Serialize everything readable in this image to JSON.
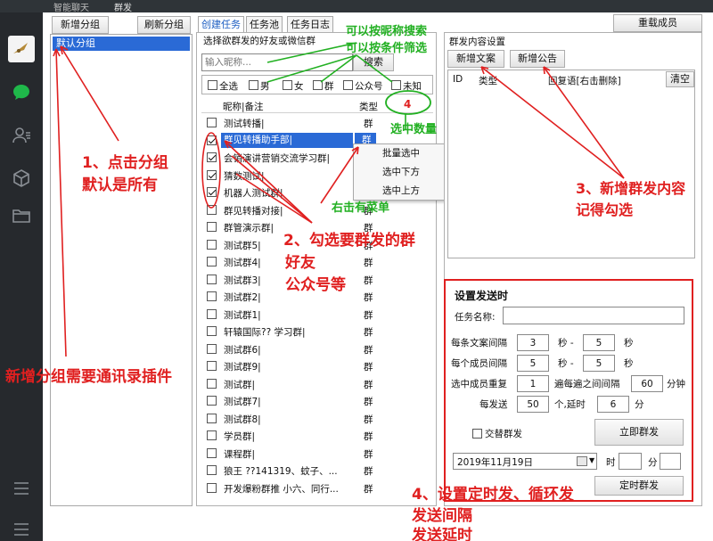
{
  "topbar": {
    "tab1": "智能聊天",
    "tab2": "群发"
  },
  "groups": {
    "add_btn": "新增分组",
    "refresh_btn": "刷新分组",
    "items": [
      "默认分组"
    ]
  },
  "tabs": [
    "创建任务",
    "任务池",
    "任务日志"
  ],
  "reload_btn": "重载成员",
  "friend_panel": {
    "title": "选择欲群发的好友或微信群",
    "search_placeholder": "输入昵称...",
    "search_btn": "搜索",
    "filters": [
      "全选",
      "男",
      "女",
      "群",
      "公众号",
      "未知"
    ],
    "col_name": "昵称|备注",
    "col_type": "类型",
    "selected_count": "4",
    "rows": [
      {
        "name": "测试转播|",
        "type": "群",
        "checked": false,
        "selected": false
      },
      {
        "name": "群见转播助手部|",
        "type": "群",
        "checked": true,
        "selected": true
      },
      {
        "name": "会销演讲营销交流学习群|",
        "type": "群",
        "checked": true,
        "selected": false
      },
      {
        "name": "猜数测试|",
        "type": "群",
        "checked": true,
        "selected": false
      },
      {
        "name": "机器人测试群|",
        "type": "群",
        "checked": true,
        "selected": false
      },
      {
        "name": "群见转播对接|",
        "type": "群",
        "checked": false,
        "selected": false
      },
      {
        "name": "群管演示群|",
        "type": "群",
        "checked": false,
        "selected": false
      },
      {
        "name": "测试群5|",
        "type": "群",
        "checked": false,
        "selected": false
      },
      {
        "name": "测试群4|",
        "type": "群",
        "checked": false,
        "selected": false
      },
      {
        "name": "测试群3|",
        "type": "群",
        "checked": false,
        "selected": false
      },
      {
        "name": "测试群2|",
        "type": "群",
        "checked": false,
        "selected": false
      },
      {
        "name": "测试群1|",
        "type": "群",
        "checked": false,
        "selected": false
      },
      {
        "name": "轩辕国际?? 学习群|",
        "type": "群",
        "checked": false,
        "selected": false
      },
      {
        "name": "测试群6|",
        "type": "群",
        "checked": false,
        "selected": false
      },
      {
        "name": "测试群9|",
        "type": "群",
        "checked": false,
        "selected": false
      },
      {
        "name": "测试群|",
        "type": "群",
        "checked": false,
        "selected": false
      },
      {
        "name": "测试群7|",
        "type": "群",
        "checked": false,
        "selected": false
      },
      {
        "name": "测试群8|",
        "type": "群",
        "checked": false,
        "selected": false
      },
      {
        "name": "学员群|",
        "type": "群",
        "checked": false,
        "selected": false
      },
      {
        "name": "课程群|",
        "type": "群",
        "checked": false,
        "selected": false
      },
      {
        "name": "狼王 ??141319、蚊子、...",
        "type": "群",
        "checked": false,
        "selected": false
      },
      {
        "name": "开发爆粉群推 小六、同行...",
        "type": "群",
        "checked": false,
        "selected": false
      }
    ]
  },
  "context_menu": [
    "批量选中",
    "选中下方",
    "选中上方"
  ],
  "content_panel": {
    "title": "群发内容设置",
    "add_text_btn": "新增文案",
    "add_notice_btn": "新增公告",
    "cols": [
      "ID",
      "类型",
      "回复语[右击删除]"
    ],
    "clear_btn": "清空"
  },
  "settings": {
    "title": "设置发送时",
    "task_name_label": "任务名称:",
    "task_name_value": "",
    "text_interval_label": "每条文案间隔",
    "text_interval_min": "3",
    "text_interval_max": "5",
    "member_interval_label": "每个成员间隔",
    "member_interval_min": "5",
    "member_interval_max": "5",
    "sec_dash": "秒 -",
    "sec": "秒",
    "repeat_label": "选中成员重复",
    "repeat_value": "1",
    "repeat_suffix": "遍每遍之间间隔",
    "repeat_interval": "60",
    "minute_label": "分钟",
    "per_send_label": "每发送",
    "per_send_value": "50",
    "per_send_mid": "个,延时",
    "per_send_delay": "6",
    "per_send_unit": "分",
    "alternate_label": "交替群发",
    "send_now_btn": "立即群发",
    "date_value": "2019年11月19日",
    "hour_label": "时",
    "minute_short": "分",
    "timed_btn": "定时群发"
  },
  "annotations": {
    "a1_line1": "1、点击分组",
    "a1_line2": "默认是所有",
    "a2_line1": "2、勾选要群发的群",
    "a2_line2": "好友",
    "a2_line3": "公众号等",
    "a3_line1": "3、新增群发内容",
    "a3_line2": "记得勾选",
    "a4_line1": "4、设置定时发、循环发",
    "a4_line2": "发送间隔",
    "a4_line3": "发送延时",
    "a_plugin": "新增分组需要通讯录插件",
    "g_search1": "可以按昵称搜索",
    "g_search2": "可以按条件筛选",
    "g_count": "选中数量",
    "g_menu": "右击有菜单"
  }
}
